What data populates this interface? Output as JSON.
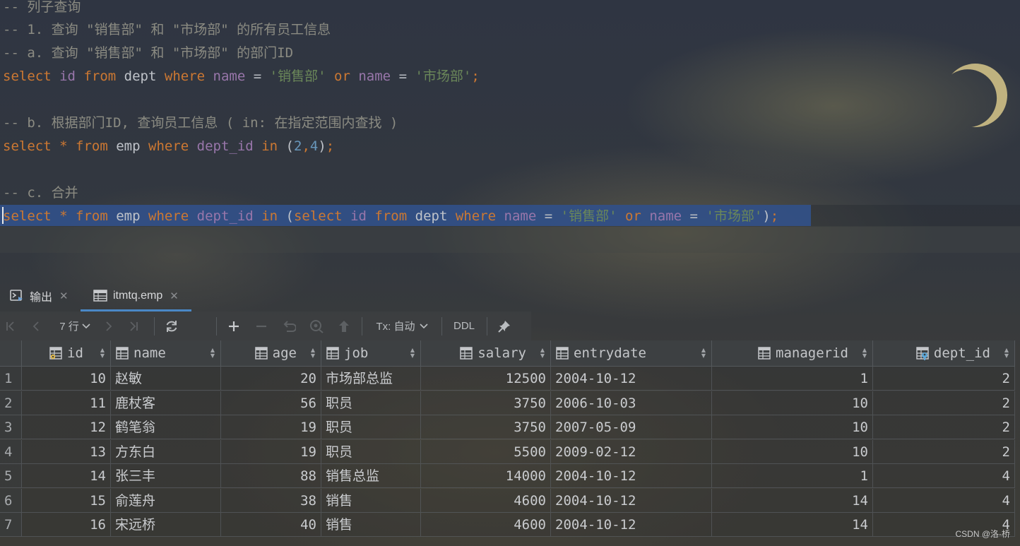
{
  "editor": {
    "comment_1": "-- 列子查询",
    "comment_2": "-- 1. 查询 \"销售部\" 和 \"市场部\" 的所有员工信息",
    "comment_3": "-- a. 查询 \"销售部\" 和 \"市场部\" 的部门ID",
    "query_a": {
      "kw_select": "select",
      "col_id": "id",
      "kw_from": "from",
      "tbl": "dept",
      "kw_where": "where",
      "col_name1": "name",
      "eq1": "=",
      "str1": "'销售部'",
      "kw_or": "or",
      "col_name2": "name",
      "eq2": "=",
      "str2": "'市场部'",
      "semi": ";"
    },
    "comment_4": "-- b. 根据部门ID, 查询员工信息 ( in: 在指定范围内查找 )",
    "query_b": {
      "kw_select": "select",
      "star": "*",
      "kw_from": "from",
      "tbl": "emp",
      "kw_where": "where",
      "col": "dept_id",
      "kw_in": "in",
      "paren_open": "(",
      "n1": "2",
      "comma": ",",
      "n2": "4",
      "paren_close": ")",
      "semi": ";"
    },
    "comment_5": "-- c. 合并",
    "query_c": {
      "kw_select": "select",
      "star": "*",
      "kw_from": "from",
      "tbl": "emp",
      "kw_where": "where",
      "col": "dept_id",
      "kw_in": "in",
      "paren_open": "(",
      "kw_select2": "select",
      "col_id": "id",
      "kw_from2": "from",
      "tbl2": "dept",
      "kw_where2": "where",
      "col_name1": "name",
      "eq1": "=",
      "str1": "'销售部'",
      "kw_or": "or",
      "col_name2": "name",
      "eq2": "=",
      "str2": "'市场部'",
      "paren_close": ")",
      "semi": ";"
    }
  },
  "tabs": [
    {
      "label": "输出",
      "icon": "console-icon",
      "active": false
    },
    {
      "label": "itmtq.emp",
      "icon": "table-icon",
      "active": true
    }
  ],
  "toolbar": {
    "rows_label": "7 行",
    "tx_label": "Tx: 自动",
    "ddl_label": "DDL",
    "icons": [
      "first-page-icon",
      "prev-page-icon",
      "next-page-icon",
      "last-page-icon",
      "refresh-icon",
      "add-row-icon",
      "delete-row-icon",
      "revert-icon",
      "view-icon",
      "submit-icon",
      "pin-icon"
    ]
  },
  "grid": {
    "columns": [
      {
        "name": "id",
        "icon": "primary-key-icon"
      },
      {
        "name": "name",
        "icon": "column-icon"
      },
      {
        "name": "age",
        "icon": "column-icon"
      },
      {
        "name": "job",
        "icon": "column-icon"
      },
      {
        "name": "salary",
        "icon": "column-icon"
      },
      {
        "name": "entrydate",
        "icon": "column-icon"
      },
      {
        "name": "managerid",
        "icon": "column-icon"
      },
      {
        "name": "dept_id",
        "icon": "foreign-key-icon"
      }
    ],
    "rows": [
      {
        "n": "1",
        "id": "10",
        "name": "赵敏",
        "age": "20",
        "job": "市场部总监",
        "salary": "12500",
        "entrydate": "2004-10-12",
        "managerid": "1",
        "dept_id": "2"
      },
      {
        "n": "2",
        "id": "11",
        "name": "鹿杖客",
        "age": "56",
        "job": "职员",
        "salary": "3750",
        "entrydate": "2006-10-03",
        "managerid": "10",
        "dept_id": "2"
      },
      {
        "n": "3",
        "id": "12",
        "name": "鹤笔翁",
        "age": "19",
        "job": "职员",
        "salary": "3750",
        "entrydate": "2007-05-09",
        "managerid": "10",
        "dept_id": "2"
      },
      {
        "n": "4",
        "id": "13",
        "name": "方东白",
        "age": "19",
        "job": "职员",
        "salary": "5500",
        "entrydate": "2009-02-12",
        "managerid": "10",
        "dept_id": "2"
      },
      {
        "n": "5",
        "id": "14",
        "name": "张三丰",
        "age": "88",
        "job": "销售总监",
        "salary": "14000",
        "entrydate": "2004-10-12",
        "managerid": "1",
        "dept_id": "4"
      },
      {
        "n": "6",
        "id": "15",
        "name": "俞莲舟",
        "age": "38",
        "job": "销售",
        "salary": "4600",
        "entrydate": "2004-10-12",
        "managerid": "14",
        "dept_id": "4"
      },
      {
        "n": "7",
        "id": "16",
        "name": "宋远桥",
        "age": "40",
        "job": "销售",
        "salary": "4600",
        "entrydate": "2004-10-12",
        "managerid": "14",
        "dept_id": "4"
      }
    ]
  },
  "watermark": "CSDN @洛-桥"
}
